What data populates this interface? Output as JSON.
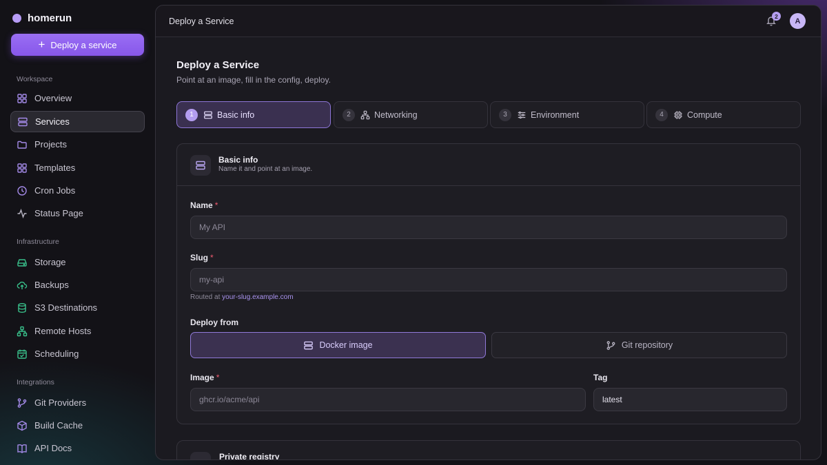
{
  "app": {
    "name": "homerun",
    "deploy_label": "Deploy a service"
  },
  "sidebar": {
    "sections": [
      {
        "label": "Workspace",
        "items": [
          {
            "label": "Overview",
            "icon": "grid-icon"
          },
          {
            "label": "Services",
            "icon": "server-icon",
            "active": true
          },
          {
            "label": "Projects",
            "icon": "folder-icon"
          },
          {
            "label": "Templates",
            "icon": "templates-icon"
          },
          {
            "label": "Cron Jobs",
            "icon": "clock-icon"
          },
          {
            "label": "Status Page",
            "icon": "activity-icon"
          }
        ]
      },
      {
        "label": "Infrastructure",
        "items": [
          {
            "label": "Storage",
            "icon": "hard-drive-icon"
          },
          {
            "label": "Backups",
            "icon": "cloud-upload-icon"
          },
          {
            "label": "S3 Destinations",
            "icon": "database-icon"
          },
          {
            "label": "Remote Hosts",
            "icon": "network-icon"
          },
          {
            "label": "Scheduling",
            "icon": "calendar-check-icon"
          }
        ]
      },
      {
        "label": "Integrations",
        "items": [
          {
            "label": "Git Providers",
            "icon": "git-branch-icon"
          },
          {
            "label": "Build Cache",
            "icon": "box-icon"
          },
          {
            "label": "API Docs",
            "icon": "book-icon"
          }
        ]
      }
    ]
  },
  "topbar": {
    "title": "Deploy a Service",
    "notification_count": "2",
    "avatar_initial": "A"
  },
  "page": {
    "title": "Deploy a Service",
    "subtitle": "Point at an image, fill in the config, deploy."
  },
  "steps": [
    {
      "number": "1",
      "label": "Basic info",
      "icon": "server-icon",
      "active": true
    },
    {
      "number": "2",
      "label": "Networking",
      "icon": "network-icon"
    },
    {
      "number": "3",
      "label": "Environment",
      "icon": "sliders-icon"
    },
    {
      "number": "4",
      "label": "Compute",
      "icon": "cpu-icon"
    }
  ],
  "basic_info": {
    "title": "Basic info",
    "description": "Name it and point at an image.",
    "name_label": "Name",
    "name_placeholder": "My API",
    "slug_label": "Slug",
    "slug_placeholder": "my-api",
    "slug_hint_prefix": "Routed at ",
    "slug_hint_link": "your-slug.example.com",
    "deploy_from_label": "Deploy from",
    "deploy_from_options": [
      "Docker image",
      "Git repository"
    ],
    "deploy_from_selected": "Docker image",
    "image_label": "Image",
    "image_placeholder": "ghcr.io/acme/api",
    "tag_label": "Tag",
    "tag_value": "latest",
    "required_mark": "*"
  },
  "private_registry": {
    "title": "Private registry"
  },
  "colors": {
    "accent": "#9a6ef4",
    "required": "#ef5a6f",
    "success_icon": "#39c08b"
  }
}
